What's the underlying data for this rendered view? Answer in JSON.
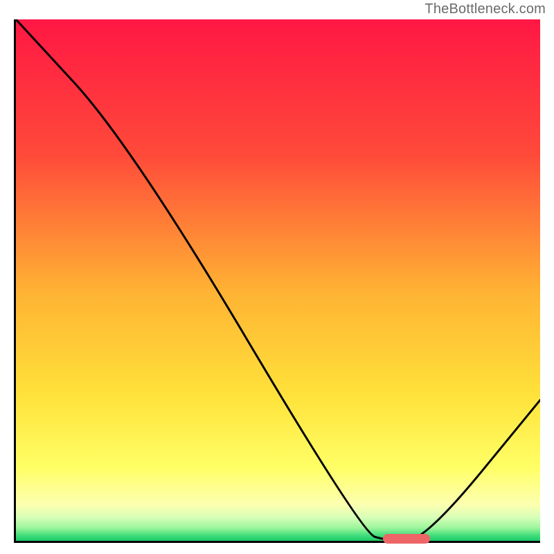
{
  "watermark": "TheBottleneck.com",
  "chart_data": {
    "type": "line",
    "title": "",
    "xlabel": "",
    "ylabel": "",
    "xlim": [
      0,
      100
    ],
    "ylim": [
      0,
      100
    ],
    "series": [
      {
        "name": "curve",
        "x": [
          0,
          22,
          66,
          71,
          78,
          100
        ],
        "values": [
          100,
          76,
          1.5,
          0,
          0,
          27
        ]
      }
    ],
    "gradient_stops": [
      {
        "offset": 0,
        "color": "#ff1744"
      },
      {
        "offset": 0.26,
        "color": "#ff4a3a"
      },
      {
        "offset": 0.52,
        "color": "#ffb233"
      },
      {
        "offset": 0.72,
        "color": "#ffe23a"
      },
      {
        "offset": 0.86,
        "color": "#ffff66"
      },
      {
        "offset": 0.93,
        "color": "#fdffb0"
      },
      {
        "offset": 0.955,
        "color": "#d8ffb8"
      },
      {
        "offset": 0.975,
        "color": "#9cf59c"
      },
      {
        "offset": 0.99,
        "color": "#40dd7a"
      },
      {
        "offset": 1.0,
        "color": "#1dc96a"
      }
    ],
    "marker": {
      "x_start": 70,
      "x_end": 79,
      "y": 0,
      "color": "#ed6566"
    }
  }
}
